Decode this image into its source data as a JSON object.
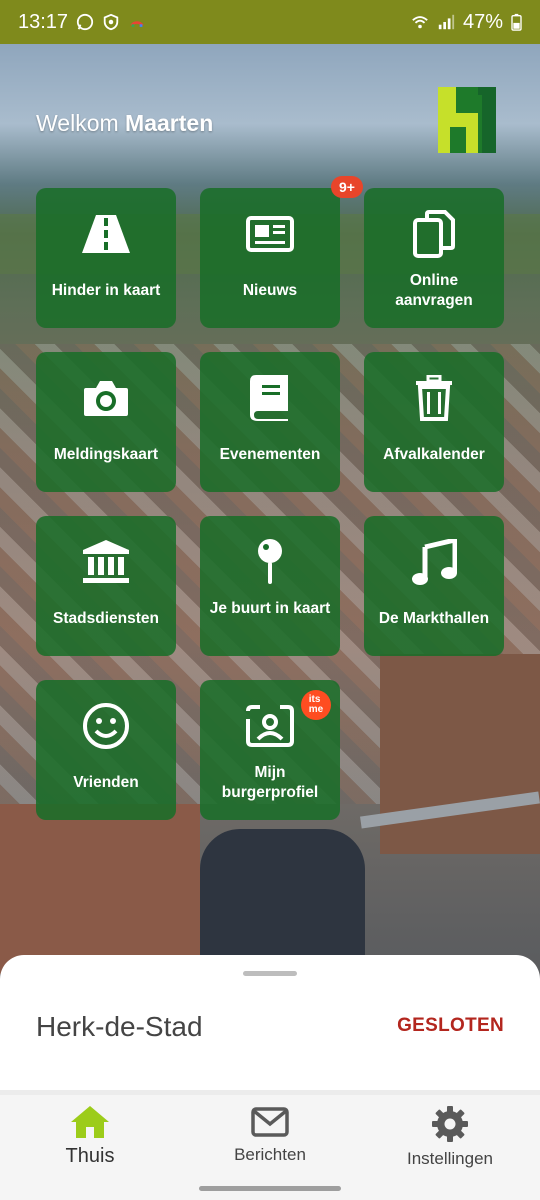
{
  "status_bar": {
    "time": "13:17",
    "battery": "47%",
    "bg_color": "#7f8a1c"
  },
  "header": {
    "greeting": "Welkom",
    "user_name": "Maarten"
  },
  "tiles": [
    {
      "label": "Hinder in kaart",
      "icon": "road-icon"
    },
    {
      "label": "Nieuws",
      "icon": "newspaper-icon",
      "badge": "9+"
    },
    {
      "label": "Online aanvragen",
      "icon": "copy-documents-icon"
    },
    {
      "label": "Meldingskaart",
      "icon": "camera-icon"
    },
    {
      "label": "Evenementen",
      "icon": "book-icon"
    },
    {
      "label": "Afvalkalender",
      "icon": "trash-icon"
    },
    {
      "label": "Stadsdiensten",
      "icon": "building-icon"
    },
    {
      "label": "Je buurt in kaart",
      "icon": "map-pin-icon"
    },
    {
      "label": "De Markthallen",
      "icon": "music-note-icon"
    },
    {
      "label": "Vrienden",
      "icon": "smiley-icon"
    },
    {
      "label": "Mijn burgerprofiel",
      "icon": "id-profile-icon",
      "badge": "itsme"
    }
  ],
  "sheet": {
    "city": "Herk-de-Stad",
    "status": "GESLOTEN"
  },
  "nav": {
    "items": [
      {
        "label": "Thuis",
        "icon": "home-icon",
        "active": true
      },
      {
        "label": "Berichten",
        "icon": "mail-icon",
        "active": false
      },
      {
        "label": "Instellingen",
        "icon": "gear-icon",
        "active": false
      }
    ]
  },
  "colors": {
    "tile": "#186e28",
    "accent_active": "#9ccc1a",
    "closed": "#b3261e",
    "itsme": "#ff4d21"
  }
}
